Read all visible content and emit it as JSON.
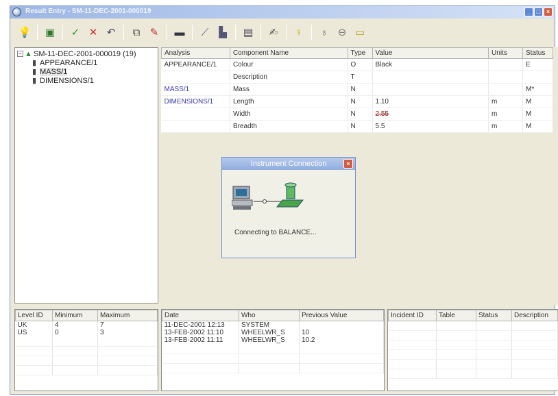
{
  "window": {
    "title": "Result Entry - SM-11-DEC-2001-000019"
  },
  "toolbar": {
    "icons": [
      "lightbulb-icon",
      "save-icon",
      "checkmark-icon",
      "cross-icon",
      "undo-icon",
      "copy-icon",
      "edit-icon",
      "monitor-icon",
      "chart-line-icon",
      "chart-bar-icon",
      "book-icon",
      "signature-icon",
      "help-bulb-icon",
      "flask-icon",
      "tube-icon",
      "folder-icon"
    ]
  },
  "tree": {
    "root": "SM-11-DEC-2001-000019 (19)",
    "expander": "−",
    "children": [
      "APPEARANCE/1",
      "MASS/1",
      "DIMENSIONS/1"
    ]
  },
  "results": {
    "headers": [
      "Analysis",
      "Component Name",
      "Type",
      "Value",
      "Units",
      "Status"
    ],
    "rows": [
      {
        "analysis": "APPEARANCE/1",
        "component": "Colour",
        "type": "O",
        "value": "Black",
        "units": "",
        "status": "E"
      },
      {
        "analysis": "",
        "component": "Description",
        "type": "T",
        "value": "",
        "units": "",
        "status": ""
      },
      {
        "analysis": "MASS/1",
        "component": "Mass",
        "type": "N",
        "value": "",
        "units": "",
        "status": "M*"
      },
      {
        "analysis": "DIMENSIONS/1",
        "component": "Length",
        "type": "N",
        "value": "1.10",
        "units": "m",
        "status": "M"
      },
      {
        "analysis": "",
        "component": "Width",
        "type": "N",
        "value": "2.55",
        "units": "m",
        "status": "M"
      },
      {
        "analysis": "",
        "component": "Breadth",
        "type": "N",
        "value": "5.5",
        "units": "m",
        "status": "M"
      }
    ]
  },
  "dialog": {
    "title": "Instrument Connection",
    "message": "Connecting to BALANCE...",
    "close": "×"
  },
  "levels": {
    "headers": [
      "Level ID",
      "Minimum",
      "Maximum"
    ],
    "rows": [
      {
        "id": "UK",
        "min": "4",
        "max": "7"
      },
      {
        "id": "US",
        "min": "0",
        "max": "3"
      }
    ]
  },
  "history": {
    "headers": [
      "Date",
      "Who",
      "Previous Value"
    ],
    "rows": [
      {
        "date": "11-DEC-2001 12:13",
        "who": "SYSTEM",
        "prev": ""
      },
      {
        "date": "13-FEB-2002 11:10",
        "who": "WHEELWR_S",
        "prev": "10"
      },
      {
        "date": "13-FEB-2002 11:11",
        "who": "WHEELWR_S",
        "prev": "10.2"
      }
    ]
  },
  "incidents": {
    "headers": [
      "Incident ID",
      "Table",
      "Status",
      "Description"
    ]
  }
}
